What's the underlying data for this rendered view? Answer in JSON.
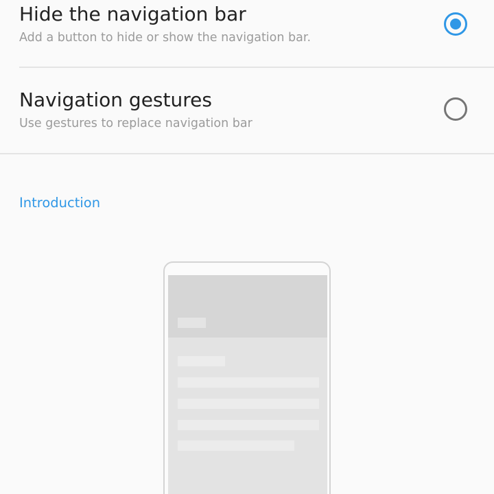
{
  "options": [
    {
      "title": "Hide the navigation bar",
      "subtitle": "Add a button to hide or show the navigation bar.",
      "selected": true
    },
    {
      "title": "Navigation gestures",
      "subtitle": "Use gestures to replace navigation bar",
      "selected": false
    }
  ],
  "section": {
    "header": "Introduction"
  },
  "colors": {
    "accent": "#2f97e6",
    "background": "#fafafa",
    "title_text": "#222222",
    "subtitle_text": "#9a9a9a",
    "radio_unchecked": "#757575"
  },
  "icons": {
    "illustration": "phone-illustration"
  }
}
